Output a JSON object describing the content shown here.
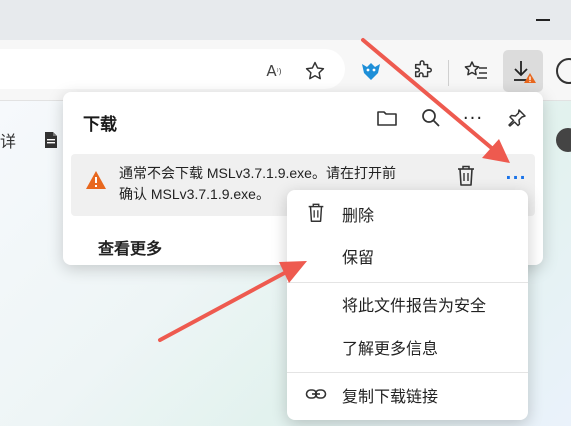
{
  "toolbar": {
    "read_aloud": "A",
    "read_aloud_sup": "⁾)"
  },
  "page": {
    "fragment_text": "详"
  },
  "downloads_panel": {
    "title": "下载",
    "item": {
      "message": "通常不会下载 MSLv3.7.1.9.exe。请在打开前确认 MSLv3.7.1.9.exe。",
      "more_label": "···"
    },
    "see_more": "查看更多",
    "more_label": "···"
  },
  "context_menu": {
    "items": [
      {
        "label": "删除",
        "icon": "trash-icon"
      },
      {
        "label": "保留",
        "icon": ""
      },
      {
        "label": "将此文件报告为安全",
        "icon": ""
      },
      {
        "label": "了解更多信息",
        "icon": ""
      },
      {
        "label": "复制下载链接",
        "icon": "link-icon"
      }
    ]
  },
  "colors": {
    "accent": "#1a73e8",
    "warning": "#e8671e",
    "arrow": "#ee5a4f"
  }
}
